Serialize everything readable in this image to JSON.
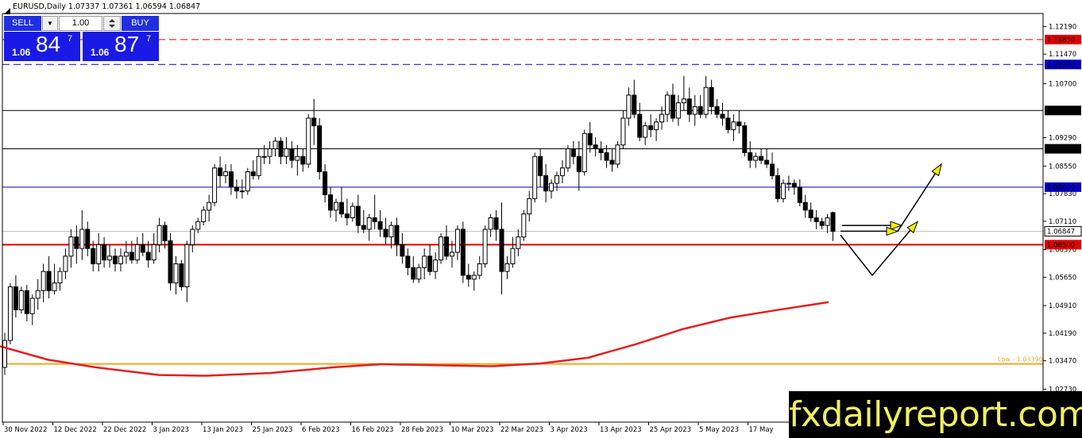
{
  "header": {
    "symbol_text": "EURUSD,Daily  1.07337 1.07361 1.06594 1.06847"
  },
  "trade_panel": {
    "sell_label": "SELL",
    "buy_label": "BUY",
    "lot_value": "1.00",
    "sell_small": "1.06",
    "sell_big": "84",
    "sell_sup": "7",
    "buy_small": "1.06",
    "buy_big": "87",
    "buy_sup": "7"
  },
  "watermark": "fxdailyreport.com",
  "colors": {
    "bull": "#ffffff",
    "bear": "#000000",
    "ma": "#e02020",
    "low_line": "#f5a623",
    "red_level": "#e00000",
    "blue_level": "#0000c0",
    "arrow_fill": "#f0f000"
  },
  "chart_data": {
    "type": "candlestick",
    "symbol": "EURUSD",
    "timeframe": "Daily",
    "last_ohlc": {
      "open": 1.07337,
      "high": 1.07361,
      "low": 1.06594,
      "close": 1.06847
    },
    "ylim": [
      1.0187,
      1.1253
    ],
    "y_ticks": [
      "1.12190",
      "1.11470",
      "1.10700",
      "1.09290",
      "1.08550",
      "1.07830",
      "1.07110",
      "1.06370",
      "1.05650",
      "1.04910",
      "1.04190",
      "1.03470",
      "1.02730"
    ],
    "x_ticks": [
      "30 Nov 2022",
      "12 Dec 2022",
      "22 Dec 2022",
      "3 Jan 2023",
      "13 Jan 2023",
      "25 Jan 2023",
      "6 Feb 2023",
      "16 Feb 2023",
      "28 Feb 2023",
      "10 Mar 2023",
      "22 Mar 2023",
      "3 Apr 2023",
      "13 Apr 2023",
      "25 Apr 2023",
      "5 May 2023",
      "17 May"
    ],
    "levels": [
      {
        "price": 1.1185,
        "label": "1.11850",
        "color": "#e00000",
        "style": "dashed"
      },
      {
        "price": 1.112,
        "label": "1.11200",
        "color": "#0000c0",
        "style": "dashed"
      },
      {
        "price": 1.1,
        "label": "1.10000",
        "color": "#000000",
        "style": "solid"
      },
      {
        "price": 1.09,
        "label": "1.09000",
        "color": "#000000",
        "style": "solid"
      },
      {
        "price": 1.08,
        "label": "1.08000",
        "color": "#0000c0",
        "style": "solid"
      },
      {
        "price": 1.06847,
        "label": "1.06847",
        "color": "#c0c0c0",
        "style": "solid"
      },
      {
        "price": 1.065,
        "label": "1.06500",
        "color": "#e00000",
        "style": "solid"
      }
    ],
    "low_marker": {
      "price": 1.0339,
      "label": "Low - 1.03390"
    },
    "candles": [
      [
        1.033,
        1.042,
        1.031,
        1.04
      ],
      [
        1.04,
        1.055,
        1.039,
        1.054
      ],
      [
        1.054,
        1.057,
        1.046,
        1.048
      ],
      [
        1.048,
        1.054,
        1.047,
        1.053
      ],
      [
        1.053,
        1.0545,
        1.045,
        1.047
      ],
      [
        1.047,
        1.052,
        1.044,
        1.051
      ],
      [
        1.051,
        1.056,
        1.048,
        1.053
      ],
      [
        1.053,
        1.06,
        1.05,
        1.058
      ],
      [
        1.058,
        1.062,
        1.051,
        1.053
      ],
      [
        1.053,
        1.06,
        1.052,
        1.055
      ],
      [
        1.055,
        1.059,
        1.053,
        1.058
      ],
      [
        1.058,
        1.064,
        1.056,
        1.062
      ],
      [
        1.062,
        1.069,
        1.059,
        1.067
      ],
      [
        1.067,
        1.07,
        1.06,
        1.064
      ],
      [
        1.064,
        1.074,
        1.061,
        1.069
      ],
      [
        1.069,
        1.071,
        1.062,
        1.064
      ],
      [
        1.064,
        1.066,
        1.058,
        1.06
      ],
      [
        1.06,
        1.068,
        1.058,
        1.065
      ],
      [
        1.065,
        1.067,
        1.059,
        1.061
      ],
      [
        1.061,
        1.065,
        1.059,
        1.062
      ],
      [
        1.062,
        1.064,
        1.058,
        1.06
      ],
      [
        1.06,
        1.064,
        1.058,
        1.062
      ],
      [
        1.062,
        1.066,
        1.06,
        1.063
      ],
      [
        1.063,
        1.066,
        1.06,
        1.061
      ],
      [
        1.061,
        1.067,
        1.06,
        1.065
      ],
      [
        1.065,
        1.068,
        1.062,
        1.063
      ],
      [
        1.063,
        1.066,
        1.059,
        1.061
      ],
      [
        1.061,
        1.068,
        1.06,
        1.065
      ],
      [
        1.065,
        1.072,
        1.063,
        1.07
      ],
      [
        1.07,
        1.071,
        1.064,
        1.066
      ],
      [
        1.066,
        1.068,
        1.053,
        1.055
      ],
      [
        1.055,
        1.062,
        1.052,
        1.06
      ],
      [
        1.06,
        1.061,
        1.053,
        1.054
      ],
      [
        1.054,
        1.066,
        1.05,
        1.065
      ],
      [
        1.065,
        1.07,
        1.063,
        1.069
      ],
      [
        1.069,
        1.072,
        1.068,
        1.071
      ],
      [
        1.071,
        1.075,
        1.07,
        1.074
      ],
      [
        1.074,
        1.078,
        1.071,
        1.076
      ],
      [
        1.076,
        1.086,
        1.075,
        1.085
      ],
      [
        1.085,
        1.088,
        1.08,
        1.083
      ],
      [
        1.083,
        1.086,
        1.081,
        1.084
      ],
      [
        1.084,
        1.086,
        1.078,
        1.08
      ],
      [
        1.08,
        1.082,
        1.077,
        1.079
      ],
      [
        1.079,
        1.082,
        1.077,
        1.079
      ],
      [
        1.079,
        1.085,
        1.078,
        1.084
      ],
      [
        1.084,
        1.087,
        1.082,
        1.083
      ],
      [
        1.083,
        1.09,
        1.082,
        1.088
      ],
      [
        1.088,
        1.091,
        1.086,
        1.088
      ],
      [
        1.088,
        1.092,
        1.086,
        1.09
      ],
      [
        1.09,
        1.093,
        1.088,
        1.092
      ],
      [
        1.092,
        1.093,
        1.086,
        1.088
      ],
      [
        1.088,
        1.093,
        1.086,
        1.09
      ],
      [
        1.09,
        1.092,
        1.085,
        1.087
      ],
      [
        1.087,
        1.091,
        1.083,
        1.088
      ],
      [
        1.088,
        1.09,
        1.084,
        1.086
      ],
      [
        1.086,
        1.099,
        1.085,
        1.098
      ],
      [
        1.098,
        1.103,
        1.091,
        1.096
      ],
      [
        1.096,
        1.098,
        1.082,
        1.084
      ],
      [
        1.084,
        1.086,
        1.076,
        1.078
      ],
      [
        1.078,
        1.08,
        1.072,
        1.074
      ],
      [
        1.074,
        1.077,
        1.071,
        1.076
      ],
      [
        1.076,
        1.08,
        1.072,
        1.073
      ],
      [
        1.073,
        1.077,
        1.07,
        1.072
      ],
      [
        1.072,
        1.076,
        1.071,
        1.075
      ],
      [
        1.075,
        1.078,
        1.068,
        1.07
      ],
      [
        1.07,
        1.074,
        1.068,
        1.069
      ],
      [
        1.069,
        1.073,
        1.066,
        1.072
      ],
      [
        1.072,
        1.078,
        1.069,
        1.071
      ],
      [
        1.071,
        1.074,
        1.067,
        1.069
      ],
      [
        1.069,
        1.072,
        1.065,
        1.067
      ],
      [
        1.067,
        1.071,
        1.064,
        1.07
      ],
      [
        1.07,
        1.072,
        1.062,
        1.065
      ],
      [
        1.065,
        1.068,
        1.06,
        1.062
      ],
      [
        1.062,
        1.064,
        1.057,
        1.059
      ],
      [
        1.059,
        1.062,
        1.055,
        1.056
      ],
      [
        1.056,
        1.06,
        1.055,
        1.059
      ],
      [
        1.059,
        1.064,
        1.056,
        1.062
      ],
      [
        1.062,
        1.065,
        1.057,
        1.058
      ],
      [
        1.058,
        1.063,
        1.056,
        1.061
      ],
      [
        1.061,
        1.068,
        1.06,
        1.067
      ],
      [
        1.067,
        1.07,
        1.061,
        1.062
      ],
      [
        1.062,
        1.066,
        1.059,
        1.063
      ],
      [
        1.063,
        1.07,
        1.061,
        1.069
      ],
      [
        1.069,
        1.071,
        1.055,
        1.057
      ],
      [
        1.057,
        1.06,
        1.054,
        1.056
      ],
      [
        1.056,
        1.058,
        1.053,
        1.057
      ],
      [
        1.057,
        1.062,
        1.056,
        1.06
      ],
      [
        1.06,
        1.07,
        1.059,
        1.069
      ],
      [
        1.069,
        1.073,
        1.067,
        1.072
      ],
      [
        1.072,
        1.074,
        1.066,
        1.069
      ],
      [
        1.069,
        1.076,
        1.052,
        1.058
      ],
      [
        1.058,
        1.062,
        1.056,
        1.06
      ],
      [
        1.06,
        1.067,
        1.059,
        1.064
      ],
      [
        1.064,
        1.069,
        1.062,
        1.067
      ],
      [
        1.067,
        1.074,
        1.066,
        1.073
      ],
      [
        1.073,
        1.079,
        1.071,
        1.077
      ],
      [
        1.077,
        1.089,
        1.076,
        1.088
      ],
      [
        1.088,
        1.09,
        1.08,
        1.083
      ],
      [
        1.083,
        1.086,
        1.076,
        1.079
      ],
      [
        1.079,
        1.082,
        1.077,
        1.081
      ],
      [
        1.081,
        1.084,
        1.079,
        1.083
      ],
      [
        1.083,
        1.087,
        1.081,
        1.085
      ],
      [
        1.085,
        1.091,
        1.084,
        1.09
      ],
      [
        1.09,
        1.092,
        1.086,
        1.088
      ],
      [
        1.088,
        1.092,
        1.079,
        1.084
      ],
      [
        1.084,
        1.095,
        1.083,
        1.094
      ],
      [
        1.094,
        1.097,
        1.089,
        1.091
      ],
      [
        1.091,
        1.093,
        1.088,
        1.09
      ],
      [
        1.09,
        1.092,
        1.087,
        1.089
      ],
      [
        1.089,
        1.091,
        1.085,
        1.087
      ],
      [
        1.087,
        1.09,
        1.084,
        1.086
      ],
      [
        1.086,
        1.092,
        1.085,
        1.091
      ],
      [
        1.091,
        1.1,
        1.09,
        1.098
      ],
      [
        1.098,
        1.106,
        1.096,
        1.104
      ],
      [
        1.104,
        1.108,
        1.098,
        1.099
      ],
      [
        1.099,
        1.102,
        1.092,
        1.093
      ],
      [
        1.093,
        1.097,
        1.091,
        1.096
      ],
      [
        1.096,
        1.099,
        1.093,
        1.095
      ],
      [
        1.095,
        1.098,
        1.092,
        1.097
      ],
      [
        1.097,
        1.101,
        1.095,
        1.099
      ],
      [
        1.099,
        1.105,
        1.097,
        1.104
      ],
      [
        1.104,
        1.107,
        1.097,
        1.098
      ],
      [
        1.098,
        1.104,
        1.096,
        1.102
      ],
      [
        1.102,
        1.109,
        1.1,
        1.103
      ],
      [
        1.103,
        1.106,
        1.097,
        1.099
      ],
      [
        1.099,
        1.104,
        1.096,
        1.101
      ],
      [
        1.101,
        1.104,
        1.098,
        1.099
      ],
      [
        1.099,
        1.109,
        1.098,
        1.106
      ],
      [
        1.106,
        1.108,
        1.099,
        1.101
      ],
      [
        1.101,
        1.103,
        1.098,
        1.099
      ],
      [
        1.099,
        1.102,
        1.096,
        1.098
      ],
      [
        1.098,
        1.1,
        1.094,
        1.095
      ],
      [
        1.095,
        1.099,
        1.092,
        1.097
      ],
      [
        1.097,
        1.1,
        1.094,
        1.096
      ],
      [
        1.096,
        1.097,
        1.088,
        1.089
      ],
      [
        1.089,
        1.092,
        1.085,
        1.087
      ],
      [
        1.087,
        1.089,
        1.085,
        1.088
      ],
      [
        1.088,
        1.09,
        1.086,
        1.087
      ],
      [
        1.087,
        1.09,
        1.085,
        1.086
      ],
      [
        1.086,
        1.089,
        1.082,
        1.083
      ],
      [
        1.083,
        1.085,
        1.076,
        1.077
      ],
      [
        1.077,
        1.082,
        1.076,
        1.081
      ],
      [
        1.081,
        1.083,
        1.079,
        1.081
      ],
      [
        1.081,
        1.082,
        1.078,
        1.08
      ],
      [
        1.08,
        1.082,
        1.075,
        1.076
      ],
      [
        1.076,
        1.078,
        1.072,
        1.074
      ],
      [
        1.074,
        1.076,
        1.071,
        1.072
      ],
      [
        1.072,
        1.074,
        1.069,
        1.071
      ],
      [
        1.071,
        1.072,
        1.069,
        1.07
      ],
      [
        1.07,
        1.073,
        1.068,
        1.072
      ],
      [
        1.07337,
        1.07361,
        1.06594,
        1.06847
      ]
    ],
    "moving_average": [
      [
        0,
        1.0385
      ],
      [
        60,
        1.035
      ],
      [
        120,
        1.033
      ],
      [
        200,
        1.031
      ],
      [
        260,
        1.0308
      ],
      [
        340,
        1.0315
      ],
      [
        420,
        1.033
      ],
      [
        480,
        1.0338
      ],
      [
        560,
        1.0335
      ],
      [
        620,
        1.0333
      ],
      [
        680,
        1.034
      ],
      [
        740,
        1.0355
      ],
      [
        800,
        1.039
      ],
      [
        860,
        1.043
      ],
      [
        920,
        1.046
      ],
      [
        980,
        1.048
      ],
      [
        1043,
        1.05
      ]
    ],
    "projection_arrows": [
      [
        [
          1060,
          1.07
        ],
        [
          1135,
          1.07
        ]
      ],
      [
        [
          1058,
          1.0685
        ],
        [
          1130,
          1.0685
        ]
      ],
      [
        [
          1058,
          1.0675
        ],
        [
          1098,
          1.057
        ],
        [
          1155,
          1.071
        ]
      ],
      [
        [
          1130,
          1.0685
        ],
        [
          1185,
          1.086
        ]
      ]
    ]
  }
}
